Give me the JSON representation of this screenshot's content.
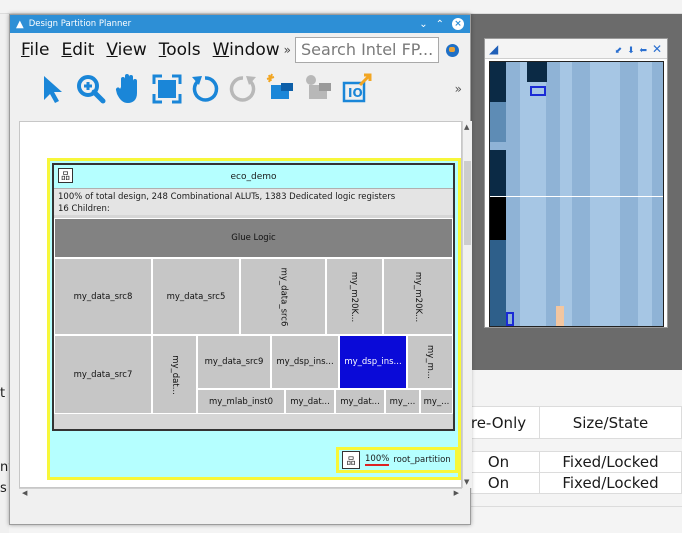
{
  "window": {
    "title": "Design Partition Planner",
    "controls": {
      "minimize": "⌄",
      "maximize": "⌃",
      "close": "×"
    }
  },
  "menu": {
    "items": [
      {
        "label": "File",
        "mnemonic": "F",
        "rest": "ile"
      },
      {
        "label": "Edit",
        "mnemonic": "E",
        "rest": "dit"
      },
      {
        "label": "View",
        "mnemonic": "V",
        "rest": "iew"
      },
      {
        "label": "Tools",
        "mnemonic": "T",
        "rest": "ools"
      },
      {
        "label": "Window",
        "mnemonic": "W",
        "rest": "indow"
      }
    ],
    "more": "»",
    "search_placeholder": "Search Intel FP..."
  },
  "toolbar": {
    "tools": [
      "select-pointer",
      "zoom-in",
      "pan-hand",
      "fit-in-window",
      "undo",
      "redo",
      "create-partition",
      "remove-partition",
      "io-assignment"
    ],
    "more": "»"
  },
  "diagram": {
    "top_entity": "eco_demo",
    "summary": "100% of total design, 248 Combinational ALUTs, 1383 Dedicated logic registers",
    "children": "16 Children:",
    "glue": "Glue Logic",
    "tiles": {
      "src8": "my_data_src8",
      "src5": "my_data_src5",
      "src6": "my_data_src6",
      "m20k_a": "my_m20K...",
      "m20k_b": "my_m20K...",
      "src7": "my_data_src7",
      "dat_v": "my_dat...",
      "src9": "my_data_src9",
      "dsp1": "my_dsp_ins...",
      "dsp2": "my_dsp_ins...",
      "m_v": "my_m...",
      "mlab0": "my_mlab_inst0",
      "dat_a": "my_dat...",
      "dat_b": "my_dat...",
      "my_a": "my_...",
      "my_b": "my_..."
    },
    "root_percent": "100%",
    "root_label": "root_partition"
  },
  "background": {
    "left_fragments": [
      "t",
      "ny",
      "s"
    ],
    "table": {
      "headers": [
        "re-Only",
        "Size/State"
      ],
      "rows": [
        [
          "On",
          "Fixed/Locked"
        ],
        [
          "On",
          "Fixed/Locked"
        ]
      ]
    }
  },
  "colors": {
    "title_bar": "#2d8fd6",
    "partition_fill": "#b5ffff",
    "partition_border": "#f7f73a",
    "selected_tile": "#0a0ad8"
  }
}
